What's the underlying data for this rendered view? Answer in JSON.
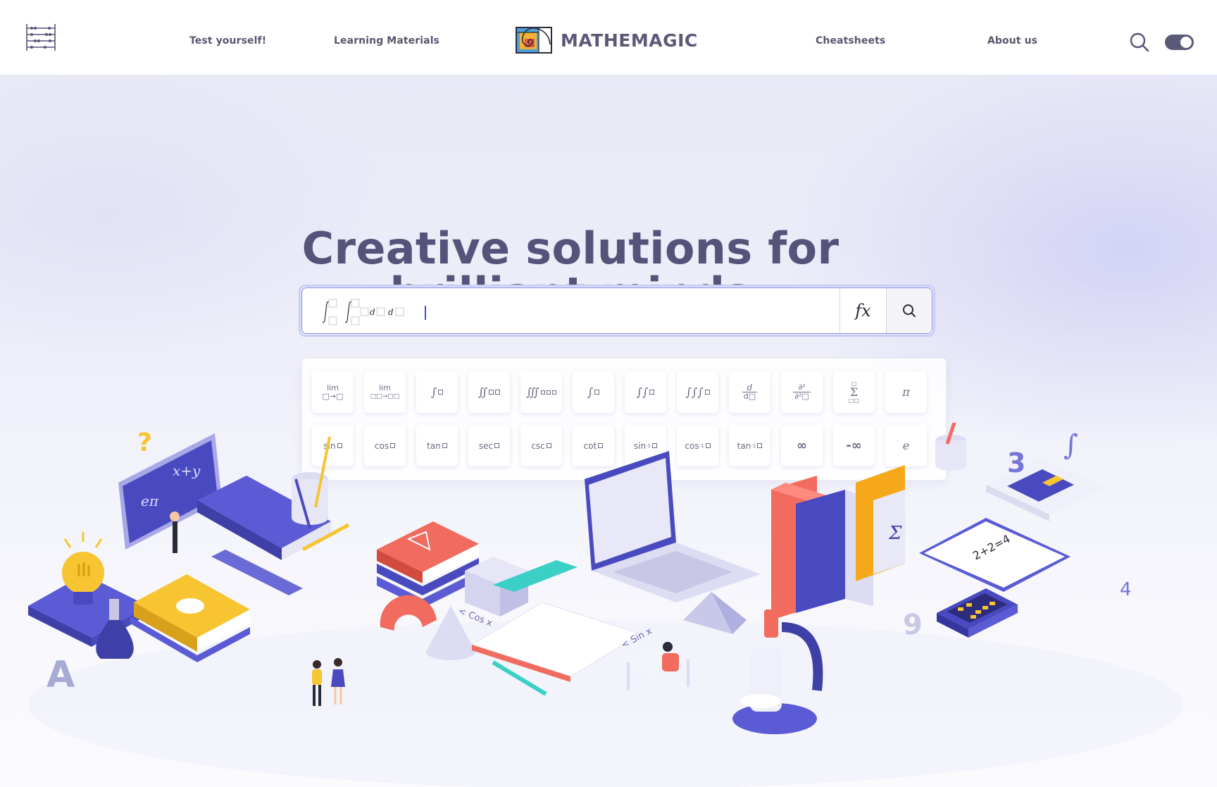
{
  "nav": {
    "links": [
      "Test yourself!",
      "Learning Materials",
      "Cheatsheets",
      "About us"
    ],
    "brand": "MATHEMAGIC",
    "icons": {
      "menu": "abacus-icon",
      "search": "search-icon",
      "toggle": "theme-toggle"
    }
  },
  "hero": {
    "headline_line1": "Creative solutions for",
    "headline_line2": "brilliant minds"
  },
  "search": {
    "value": "",
    "fx_label": "fx",
    "accent": "#6f7de8"
  },
  "palette": {
    "row1": [
      "lim",
      "lim",
      "∫",
      "∬",
      "∭",
      "∫",
      "∫∫",
      "∫∫∫",
      "d",
      "∂²",
      "Σ",
      "π"
    ],
    "row2": [
      "sin",
      "cos",
      "tan",
      "sec",
      "csc",
      "cot",
      "sin",
      "cos",
      "tan",
      "∞",
      "-∞",
      "e"
    ],
    "inverse_sup": "-1"
  },
  "illustration_text": {
    "board_formula1": "eπ",
    "board_formula2": "x+y",
    "notebook": "2+2=4",
    "cos": "< Cos x",
    "sin": "< Sin x"
  },
  "colors": {
    "brand_text": "#5b5978",
    "primary": "#5b5bd6",
    "yellow": "#f6c531",
    "coral": "#f16b5e",
    "teal": "#3ad0c6"
  }
}
